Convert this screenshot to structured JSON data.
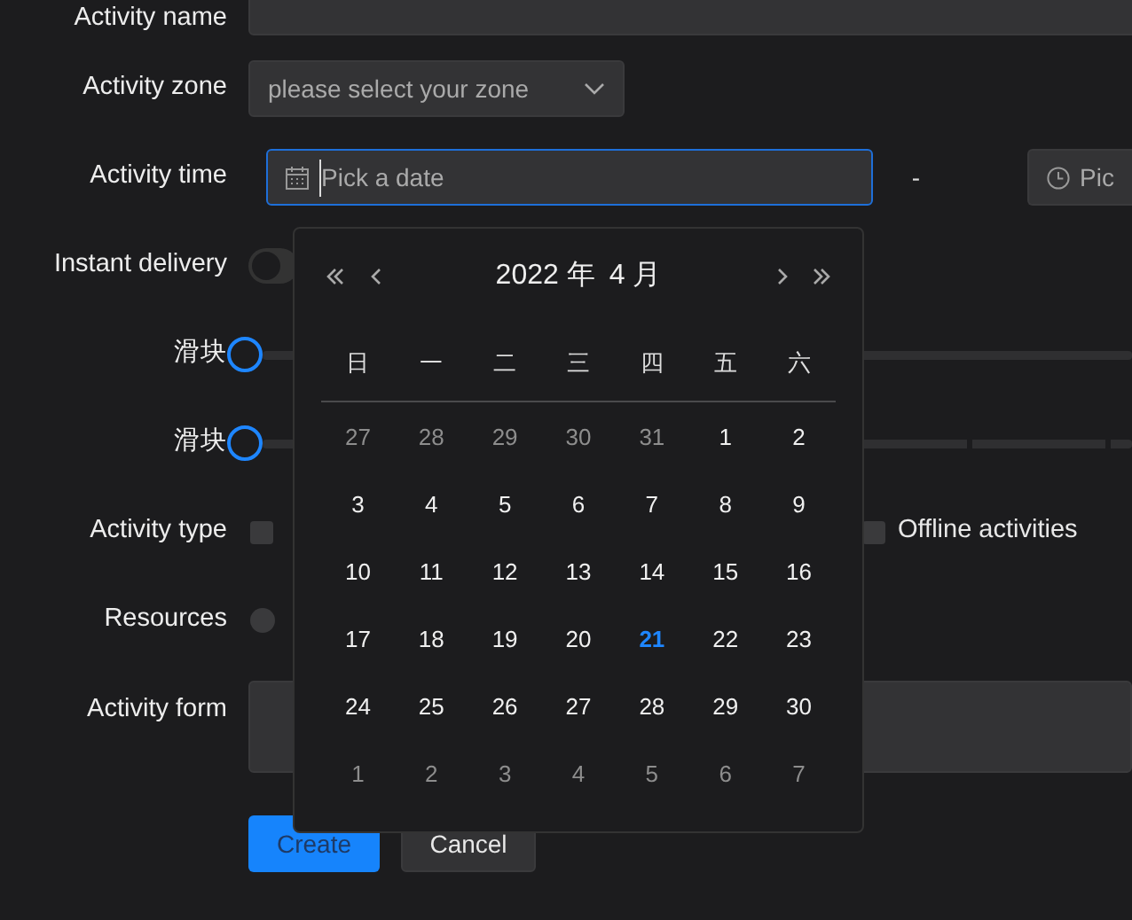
{
  "form": {
    "fields": [
      {
        "kind": "text",
        "label": "Activity name"
      },
      {
        "kind": "select",
        "label": "Activity zone",
        "placeholder": "please select your zone"
      },
      {
        "kind": "daterange",
        "label": "Activity time",
        "placeholder": "Pick a date",
        "separator": "-",
        "end_placeholder": "Pic",
        "focused": true
      },
      {
        "kind": "switch",
        "label": "Instant delivery",
        "on": false
      },
      {
        "kind": "slider",
        "label": "滑块",
        "level": 0,
        "show_stops": false
      },
      {
        "kind": "slider",
        "label": "滑块",
        "level": 0,
        "show_stops": true
      },
      {
        "kind": "checkboxes",
        "label": "Activity type",
        "options": [
          {
            "checked": false
          },
          {
            "label": "Offline activities",
            "checked": false
          }
        ]
      },
      {
        "kind": "radio",
        "label": "Resources",
        "options": [
          {
            "selected": false
          }
        ]
      },
      {
        "kind": "textarea",
        "label": "Activity form"
      }
    ],
    "buttons": [
      {
        "label": "Create",
        "kind": "primary"
      },
      {
        "label": "Cancel",
        "kind": "secondary"
      }
    ]
  },
  "date_picker": {
    "year_label": "2022 年",
    "month_label": "4 月",
    "weekdays": [
      "日",
      "一",
      "二",
      "三",
      "四",
      "五",
      "六"
    ],
    "weeks": [
      [
        {
          "day": "27",
          "in_month": false,
          "today": false
        },
        {
          "day": "28",
          "in_month": false,
          "today": false
        },
        {
          "day": "29",
          "in_month": false,
          "today": false
        },
        {
          "day": "30",
          "in_month": false,
          "today": false
        },
        {
          "day": "31",
          "in_month": false,
          "today": false
        },
        {
          "day": "1",
          "in_month": true,
          "today": false
        },
        {
          "day": "2",
          "in_month": true,
          "today": false
        }
      ],
      [
        {
          "day": "3",
          "in_month": true,
          "today": false
        },
        {
          "day": "4",
          "in_month": true,
          "today": false
        },
        {
          "day": "5",
          "in_month": true,
          "today": false
        },
        {
          "day": "6",
          "in_month": true,
          "today": false
        },
        {
          "day": "7",
          "in_month": true,
          "today": false
        },
        {
          "day": "8",
          "in_month": true,
          "today": false
        },
        {
          "day": "9",
          "in_month": true,
          "today": false
        }
      ],
      [
        {
          "day": "10",
          "in_month": true,
          "today": false
        },
        {
          "day": "11",
          "in_month": true,
          "today": false
        },
        {
          "day": "12",
          "in_month": true,
          "today": false
        },
        {
          "day": "13",
          "in_month": true,
          "today": false
        },
        {
          "day": "14",
          "in_month": true,
          "today": false
        },
        {
          "day": "15",
          "in_month": true,
          "today": false
        },
        {
          "day": "16",
          "in_month": true,
          "today": false
        }
      ],
      [
        {
          "day": "17",
          "in_month": true,
          "today": false
        },
        {
          "day": "18",
          "in_month": true,
          "today": false
        },
        {
          "day": "19",
          "in_month": true,
          "today": false
        },
        {
          "day": "20",
          "in_month": true,
          "today": false
        },
        {
          "day": "21",
          "in_month": true,
          "today": true
        },
        {
          "day": "22",
          "in_month": true,
          "today": false
        },
        {
          "day": "23",
          "in_month": true,
          "today": false
        }
      ],
      [
        {
          "day": "24",
          "in_month": true,
          "today": false
        },
        {
          "day": "25",
          "in_month": true,
          "today": false
        },
        {
          "day": "26",
          "in_month": true,
          "today": false
        },
        {
          "day": "27",
          "in_month": true,
          "today": false
        },
        {
          "day": "28",
          "in_month": true,
          "today": false
        },
        {
          "day": "29",
          "in_month": true,
          "today": false
        },
        {
          "day": "30",
          "in_month": true,
          "today": false
        }
      ],
      [
        {
          "day": "1",
          "in_month": false,
          "today": false
        },
        {
          "day": "2",
          "in_month": false,
          "today": false
        },
        {
          "day": "3",
          "in_month": false,
          "today": false
        },
        {
          "day": "4",
          "in_month": false,
          "today": false
        },
        {
          "day": "5",
          "in_month": false,
          "today": false
        },
        {
          "day": "6",
          "in_month": false,
          "today": false
        },
        {
          "day": "7",
          "in_month": false,
          "today": false
        }
      ]
    ]
  }
}
